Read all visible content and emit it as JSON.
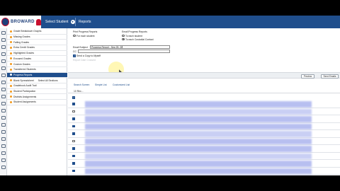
{
  "header": {
    "logo_text": "BROWARD",
    "select_student": "Select Student",
    "select_student_chevron": "▾",
    "page_title": "Reports"
  },
  "rail_icons": [
    "home-icon",
    "user-icon",
    "calendar-icon",
    "chart-icon",
    "mail-icon",
    "document-icon",
    "grid-icon",
    "list-icon",
    "clipboard-icon",
    "book-icon",
    "gear-icon",
    "folder-icon",
    "star-icon",
    "print-icon",
    "help-icon",
    "logout-icon",
    "clock-icon",
    "flag-icon",
    "bell-icon",
    "chat-icon"
  ],
  "menu": {
    "items": [
      {
        "label": "Grade Breakdown Graphs"
      },
      {
        "label": "Missing Grades"
      },
      {
        "label": "Failing Grades"
      },
      {
        "label": "Extra Credit Grades"
      },
      {
        "label": "Highlighted Grades"
      },
      {
        "label": "Excused Grades"
      },
      {
        "label": "Custom Grades"
      },
      {
        "label": "Transferred Students"
      },
      {
        "label": "Progress Reports"
      },
      {
        "label": "Blank Spreadsheet",
        "second": "Select All Sections"
      },
      {
        "label": "Gradebook Audit Trail"
      },
      {
        "label": "Student Participation"
      },
      {
        "label": "Districts Assignments"
      },
      {
        "label": "Student Assignments"
      }
    ],
    "active_index": 8
  },
  "form": {
    "print_heading": "Print Progress Reports",
    "print_option": "For each student",
    "email_heading": "Email Progress Reports",
    "email_option_1": "To each student",
    "email_option_2": "To each Custodial Contact",
    "subject_label": "Email Subject",
    "subject_value": "Progress Report - Sep 25, 2023",
    "cc_label": "CC",
    "send_copy_label": "Send a Copy to Myself",
    "send_copy_check": "✓",
    "faded_label": "Report Date Crossed"
  },
  "buttons": {
    "preview": "Preview",
    "send_emails": "Send Emails"
  },
  "tabs": {
    "search_screen": "Search Screen",
    "simple_list": "Simple List",
    "customized_list": "Customized List"
  },
  "results": {
    "header_check": "✓",
    "header_text": "10 Rec...",
    "rows_checked": [
      true,
      false,
      true,
      true,
      true,
      false,
      true,
      true,
      true,
      true,
      true,
      true
    ]
  }
}
